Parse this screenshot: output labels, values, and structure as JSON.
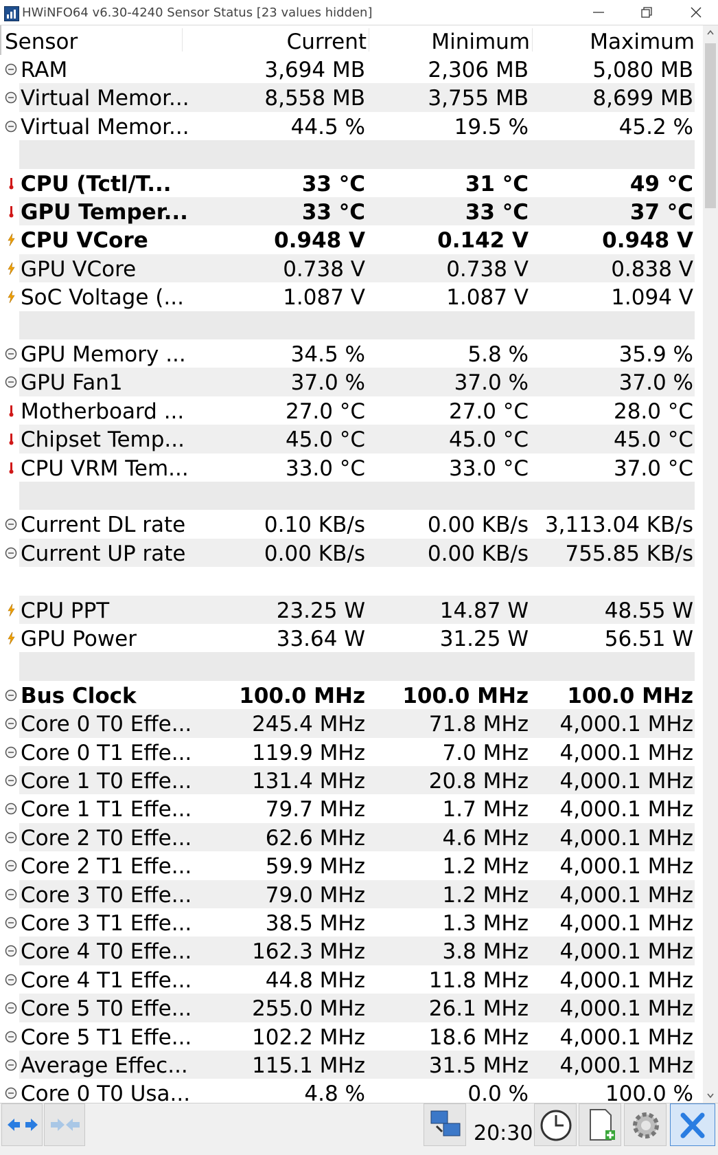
{
  "window": {
    "title": "HWiNFO64 v6.30-4240 Sensor Status [23 values hidden]"
  },
  "columns": [
    "Sensor",
    "Current",
    "Minimum",
    "Maximum"
  ],
  "rows": [
    {
      "type": "data",
      "icon": "circle",
      "name": "RAM",
      "cur": "3,694 MB",
      "min": "2,306 MB",
      "max": "5,080 MB",
      "bold": false
    },
    {
      "type": "data",
      "icon": "circle",
      "name": "Virtual Memor...",
      "cur": "8,558 MB",
      "min": "3,755 MB",
      "max": "8,699 MB",
      "bold": false
    },
    {
      "type": "data",
      "icon": "circle",
      "name": "Virtual Memor...",
      "cur": "44.5 %",
      "min": "19.5 %",
      "max": "45.2 %",
      "bold": false
    },
    {
      "type": "sep"
    },
    {
      "type": "data",
      "icon": "thermo",
      "name": "CPU (Tctl/T...",
      "cur": "33 °C",
      "min": "31 °C",
      "max": "49 °C",
      "bold": true
    },
    {
      "type": "data",
      "icon": "thermo",
      "name": "GPU Temper...",
      "cur": "33 °C",
      "min": "33 °C",
      "max": "37 °C",
      "bold": true
    },
    {
      "type": "data",
      "icon": "bolt",
      "name": "CPU VCore",
      "cur": "0.948 V",
      "min": "0.142 V",
      "max": "0.948 V",
      "bold": true
    },
    {
      "type": "data",
      "icon": "bolt",
      "name": "GPU VCore",
      "cur": "0.738 V",
      "min": "0.738 V",
      "max": "0.838 V",
      "bold": false
    },
    {
      "type": "data",
      "icon": "bolt",
      "name": "SoC Voltage (...",
      "cur": "1.087 V",
      "min": "1.087 V",
      "max": "1.094 V",
      "bold": false
    },
    {
      "type": "sep"
    },
    {
      "type": "data",
      "icon": "circle",
      "name": "GPU Memory ...",
      "cur": "34.5 %",
      "min": "5.8 %",
      "max": "35.9 %",
      "bold": false
    },
    {
      "type": "data",
      "icon": "circle",
      "name": "GPU Fan1",
      "cur": "37.0 %",
      "min": "37.0 %",
      "max": "37.0 %",
      "bold": false
    },
    {
      "type": "data",
      "icon": "thermo",
      "name": "Motherboard ...",
      "cur": "27.0 °C",
      "min": "27.0 °C",
      "max": "28.0 °C",
      "bold": false
    },
    {
      "type": "data",
      "icon": "thermo",
      "name": "Chipset Temp...",
      "cur": "45.0 °C",
      "min": "45.0 °C",
      "max": "45.0 °C",
      "bold": false
    },
    {
      "type": "data",
      "icon": "thermo",
      "name": "CPU VRM Tem...",
      "cur": "33.0 °C",
      "min": "33.0 °C",
      "max": "37.0 °C",
      "bold": false
    },
    {
      "type": "sep"
    },
    {
      "type": "data",
      "icon": "circle",
      "name": "Current DL rate",
      "cur": "0.10 KB/s",
      "min": "0.00 KB/s",
      "max": "3,113.04 KB/s",
      "bold": false
    },
    {
      "type": "data",
      "icon": "circle",
      "name": "Current UP rate",
      "cur": "0.00 KB/s",
      "min": "0.00 KB/s",
      "max": "755.85 KB/s",
      "bold": false
    },
    {
      "type": "sep"
    },
    {
      "type": "data",
      "icon": "bolt",
      "name": "CPU PPT",
      "cur": "23.25 W",
      "min": "14.87 W",
      "max": "48.55 W",
      "bold": false
    },
    {
      "type": "data",
      "icon": "bolt",
      "name": "GPU Power",
      "cur": "33.64 W",
      "min": "31.25 W",
      "max": "56.51 W",
      "bold": false
    },
    {
      "type": "sep"
    },
    {
      "type": "data",
      "icon": "circle",
      "name": "Bus Clock",
      "cur": "100.0 MHz",
      "min": "100.0 MHz",
      "max": "100.0 MHz",
      "bold": true
    },
    {
      "type": "data",
      "icon": "circle",
      "name": "Core 0 T0 Effe...",
      "cur": "245.4 MHz",
      "min": "71.8 MHz",
      "max": "4,000.1 MHz",
      "bold": false
    },
    {
      "type": "data",
      "icon": "circle",
      "name": "Core 0 T1 Effe...",
      "cur": "119.9 MHz",
      "min": "7.0 MHz",
      "max": "4,000.1 MHz",
      "bold": false
    },
    {
      "type": "data",
      "icon": "circle",
      "name": "Core 1 T0 Effe...",
      "cur": "131.4 MHz",
      "min": "20.8 MHz",
      "max": "4,000.1 MHz",
      "bold": false
    },
    {
      "type": "data",
      "icon": "circle",
      "name": "Core 1 T1 Effe...",
      "cur": "79.7 MHz",
      "min": "1.7 MHz",
      "max": "4,000.1 MHz",
      "bold": false
    },
    {
      "type": "data",
      "icon": "circle",
      "name": "Core 2 T0 Effe...",
      "cur": "62.6 MHz",
      "min": "4.6 MHz",
      "max": "4,000.1 MHz",
      "bold": false
    },
    {
      "type": "data",
      "icon": "circle",
      "name": "Core 2 T1 Effe...",
      "cur": "59.9 MHz",
      "min": "1.2 MHz",
      "max": "4,000.1 MHz",
      "bold": false
    },
    {
      "type": "data",
      "icon": "circle",
      "name": "Core 3 T0 Effe...",
      "cur": "79.0 MHz",
      "min": "1.2 MHz",
      "max": "4,000.1 MHz",
      "bold": false
    },
    {
      "type": "data",
      "icon": "circle",
      "name": "Core 3 T1 Effe...",
      "cur": "38.5 MHz",
      "min": "1.3 MHz",
      "max": "4,000.1 MHz",
      "bold": false
    },
    {
      "type": "data",
      "icon": "circle",
      "name": "Core 4 T0 Effe...",
      "cur": "162.3 MHz",
      "min": "3.8 MHz",
      "max": "4,000.1 MHz",
      "bold": false
    },
    {
      "type": "data",
      "icon": "circle",
      "name": "Core 4 T1 Effe...",
      "cur": "44.8 MHz",
      "min": "11.8 MHz",
      "max": "4,000.1 MHz",
      "bold": false
    },
    {
      "type": "data",
      "icon": "circle",
      "name": "Core 5 T0 Effe...",
      "cur": "255.0 MHz",
      "min": "26.1 MHz",
      "max": "4,000.1 MHz",
      "bold": false
    },
    {
      "type": "data",
      "icon": "circle",
      "name": "Core 5 T1 Effe...",
      "cur": "102.2 MHz",
      "min": "18.6 MHz",
      "max": "4,000.1 MHz",
      "bold": false
    },
    {
      "type": "data",
      "icon": "circle",
      "name": "Average Effec...",
      "cur": "115.1 MHz",
      "min": "31.5 MHz",
      "max": "4,000.1 MHz",
      "bold": false
    },
    {
      "type": "data",
      "icon": "circle",
      "name": "Core 0 T0 Usa...",
      "cur": "4.8 %",
      "min": "0.0 %",
      "max": "100.0 %",
      "bold": false
    }
  ],
  "toolbar": {
    "clock": "20:30",
    "buttons": [
      "nav-arrows-icon",
      "collapse-arrows-icon",
      "network-icon",
      "clock-icon",
      "report-icon",
      "settings-gear-icon",
      "close-x-icon"
    ]
  },
  "colors": {
    "alt_row": "#efefef",
    "thermo_red": "#d01818",
    "bolt_orange": "#f0a000",
    "toolbar_bg": "#f0f0f0",
    "close_blue": "#2a7de1"
  }
}
